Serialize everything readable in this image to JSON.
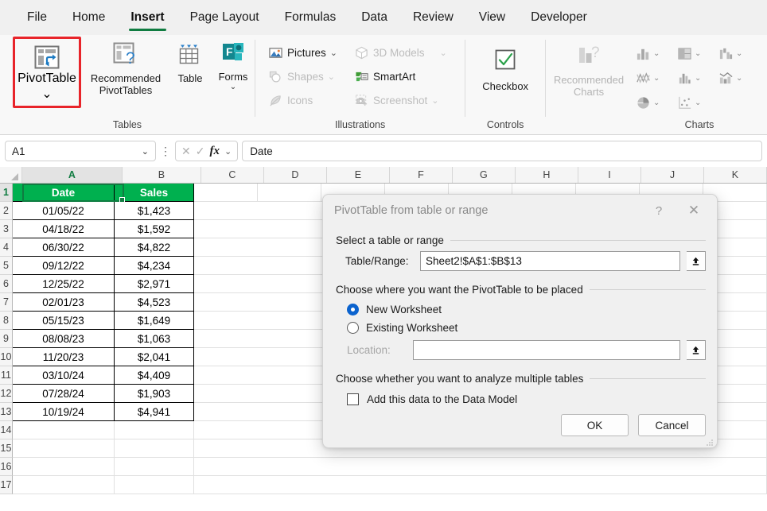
{
  "ribbon": {
    "tabs": [
      {
        "label": "File",
        "active": false
      },
      {
        "label": "Home",
        "active": false
      },
      {
        "label": "Insert",
        "active": true
      },
      {
        "label": "Page Layout",
        "active": false
      },
      {
        "label": "Formulas",
        "active": false
      },
      {
        "label": "Data",
        "active": false
      },
      {
        "label": "Review",
        "active": false
      },
      {
        "label": "View",
        "active": false
      },
      {
        "label": "Developer",
        "active": false
      }
    ],
    "groups": {
      "tables": {
        "label": "Tables",
        "pivot_table": {
          "label": "PivotTable",
          "icon": "pivottable-icon",
          "has_dropdown": true,
          "highlighted": true
        },
        "recommended_pivottables": {
          "label": "Recommended PivotTables",
          "icon": "recommended-pivottables-icon"
        },
        "table": {
          "label": "Table",
          "icon": "table-icon"
        },
        "forms": {
          "label": "Forms",
          "icon": "forms-icon",
          "has_dropdown": true
        }
      },
      "illustrations": {
        "label": "Illustrations",
        "items": [
          {
            "label": "Pictures",
            "icon": "pictures-icon",
            "disabled": false,
            "has_dropdown": true
          },
          {
            "label": "3D Models",
            "icon": "3d-models-icon",
            "disabled": true,
            "has_dropdown": true
          },
          {
            "label": "Shapes",
            "icon": "shapes-icon",
            "disabled": true,
            "has_dropdown": true
          },
          {
            "label": "SmartArt",
            "icon": "smartart-icon",
            "disabled": false,
            "has_dropdown": false
          },
          {
            "label": "Icons",
            "icon": "icons-icon",
            "disabled": true,
            "has_dropdown": false
          },
          {
            "label": "Screenshot",
            "icon": "screenshot-icon",
            "disabled": true,
            "has_dropdown": true
          }
        ]
      },
      "controls": {
        "label": "Controls",
        "checkbox": {
          "label": "Checkbox",
          "icon": "checkbox-control-icon"
        }
      },
      "charts": {
        "label": "Charts",
        "recommended_charts": {
          "label": "Recommended Charts",
          "icon": "recommended-charts-icon",
          "disabled": true
        },
        "icons": [
          "column-chart-icon",
          "hierarchy-chart-icon",
          "waterfall-chart-icon",
          "line-chart-icon",
          "statistic-chart-icon",
          "combo-chart-icon",
          "pie-chart-icon",
          "scatter-chart-icon"
        ]
      }
    }
  },
  "formula_bar": {
    "name_box": "A1",
    "cancel_icon": "cancel-icon",
    "enter_icon": "enter-icon",
    "fx_icon": "fx-icon",
    "formula_value": "Date"
  },
  "sheet": {
    "columns": [
      "A",
      "B",
      "C",
      "D",
      "E",
      "F",
      "G",
      "H",
      "I",
      "J",
      "K"
    ],
    "rows": [
      "1",
      "2",
      "3",
      "4",
      "5",
      "6",
      "7",
      "8",
      "9",
      "10",
      "11",
      "12",
      "13",
      "14",
      "15",
      "16",
      "17"
    ],
    "selected_cell": "A1",
    "header_row": [
      "Date",
      "Sales"
    ],
    "header_bg": "#00b04f",
    "data": [
      [
        "01/05/22",
        "$1,423"
      ],
      [
        "04/18/22",
        "$1,592"
      ],
      [
        "06/30/22",
        "$4,822"
      ],
      [
        "09/12/22",
        "$4,234"
      ],
      [
        "12/25/22",
        "$2,971"
      ],
      [
        "02/01/23",
        "$4,523"
      ],
      [
        "05/15/23",
        "$1,649"
      ],
      [
        "08/08/23",
        "$1,063"
      ],
      [
        "11/20/23",
        "$2,041"
      ],
      [
        "03/10/24",
        "$4,409"
      ],
      [
        "07/28/24",
        "$1,903"
      ],
      [
        "10/19/24",
        "$4,941"
      ]
    ]
  },
  "dialog": {
    "title": "PivotTable from table or range",
    "help_icon": "help-icon",
    "close_icon": "close-icon",
    "section_range": "Select a table or range",
    "table_range_label": "Table/Range:",
    "table_range_value": "Sheet2!$A$1:$B$13",
    "range_picker_icon": "range-picker-icon",
    "section_placement": "Choose where you want the PivotTable to be placed",
    "new_worksheet_label": "New Worksheet",
    "new_worksheet_selected": true,
    "existing_worksheet_label": "Existing Worksheet",
    "existing_worksheet_selected": false,
    "location_label": "Location:",
    "location_value": "",
    "location_picker_icon": "location-picker-icon",
    "section_multiple": "Choose whether you want to analyze multiple tables",
    "data_model_label": "Add this data to the Data Model",
    "data_model_checked": false,
    "ok_label": "OK",
    "cancel_label": "Cancel",
    "resize_grip_icon": "resize-grip-icon"
  },
  "colors": {
    "accent_green": "#107c41",
    "header_green": "#00b04f",
    "highlight_red": "#e8242a",
    "radio_blue": "#0b63ce"
  }
}
